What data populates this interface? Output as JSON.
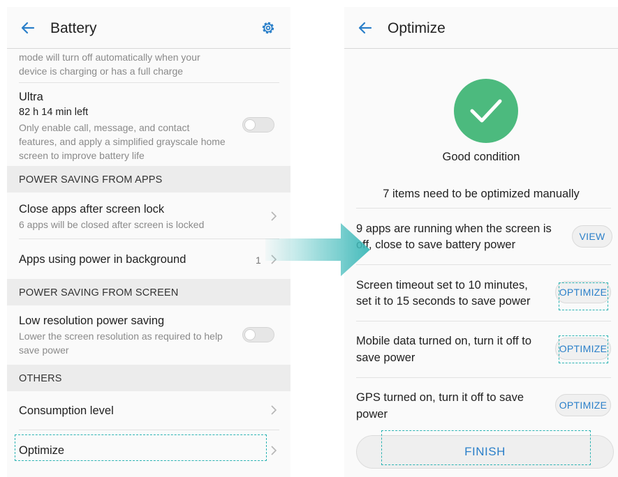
{
  "left": {
    "title": "Battery",
    "top_text_line1": "mode will turn off automatically when your",
    "top_text_line2": "device is charging or has a full charge",
    "ultra": {
      "title": "Ultra",
      "time_left": "82 h 14 min left",
      "desc": "Only enable call, message, and contact features, and apply a simplified grayscale home screen to improve battery life",
      "toggle_on": false
    },
    "section_apps": "POWER SAVING FROM APPS",
    "close_apps": {
      "title": "Close apps after screen lock",
      "desc": "6 apps will be closed after screen is locked"
    },
    "background_apps": {
      "title": "Apps using power in background",
      "count": "1"
    },
    "section_screen": "POWER SAVING FROM SCREEN",
    "low_res": {
      "title": "Low resolution power saving",
      "desc": "Lower the screen resolution as required to help save power",
      "toggle_on": false
    },
    "section_others": "OTHERS",
    "consumption": "Consumption level",
    "optimize": "Optimize"
  },
  "right": {
    "title": "Optimize",
    "status": "Good condition",
    "items_summary": "7 items need to be optimized manually",
    "items": [
      {
        "line1": "9 apps are running when the screen is",
        "line2": "off, close to save battery power",
        "action": "VIEW"
      },
      {
        "line1": "Screen timeout set to 10 minutes,",
        "line2": "set it to 15 seconds to save power",
        "action": "OPTIMIZE"
      },
      {
        "line1": "Mobile data turned on, turn it off to",
        "line2": "save power",
        "action": "OPTIMIZE"
      },
      {
        "line1": "GPS turned on, turn it off to save",
        "line2": "power",
        "action": "OPTIMIZE"
      }
    ],
    "finish": "FINISH"
  },
  "colors": {
    "accent_blue": "#2a7fc9",
    "success_green": "#4cba7e",
    "highlight_teal": "#2bb3b3"
  },
  "icons": [
    "back-arrow-icon",
    "gear-icon",
    "chevron-right-icon",
    "checkmark-icon",
    "flow-arrow-icon"
  ]
}
